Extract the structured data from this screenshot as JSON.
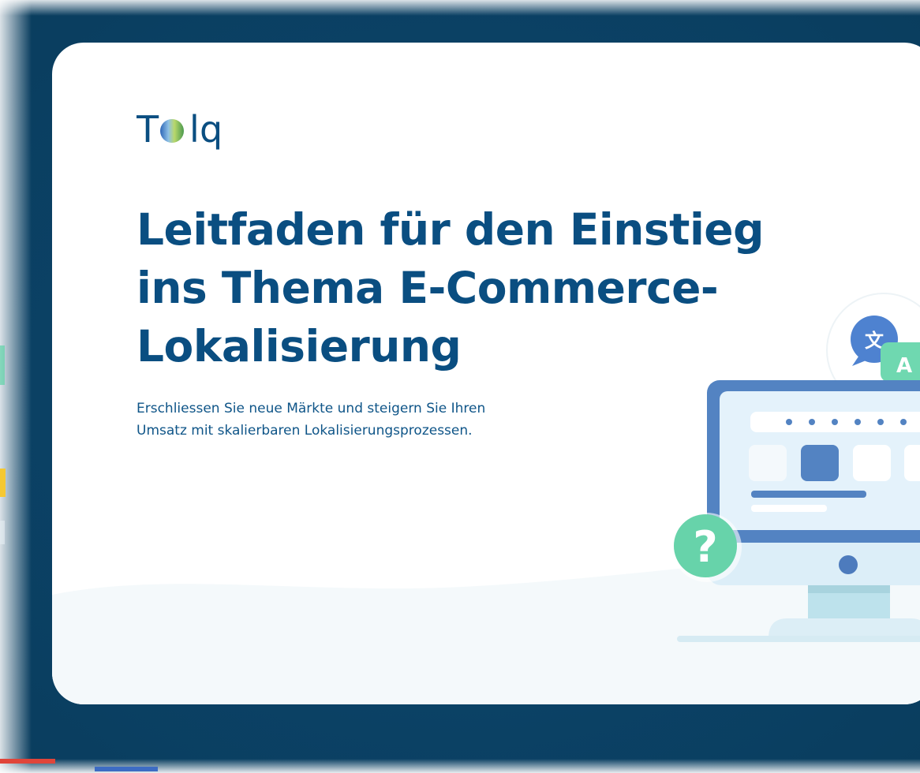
{
  "brand": {
    "logo_text": "Tolq",
    "logo_letters": [
      "T",
      "l",
      "q"
    ],
    "colors": {
      "primary": "#0a4e81",
      "backdrop": "#0b4266",
      "accent_green": "#5fd3a8",
      "accent_blue": "#4e8ad6",
      "accent_yellow": "#f5c832"
    }
  },
  "hero": {
    "headline_lines": [
      "Leitfaden für den Einstieg",
      "ins Thema E-Commerce-",
      "Lokalisierung"
    ],
    "subtitle_lines": [
      "Erschliessen Sie neue Märkte und steigern Sie Ihren",
      "Umsatz mit skalierbaren Lokalisierungsprozessen."
    ]
  },
  "illustration": {
    "translate_bubble_glyph": "文",
    "letter_bubble_glyph": "A",
    "question_badge_glyph": "?",
    "icons": [
      "translate-icon",
      "letter-a-icon",
      "question-icon",
      "computer-monitor-icon"
    ]
  }
}
